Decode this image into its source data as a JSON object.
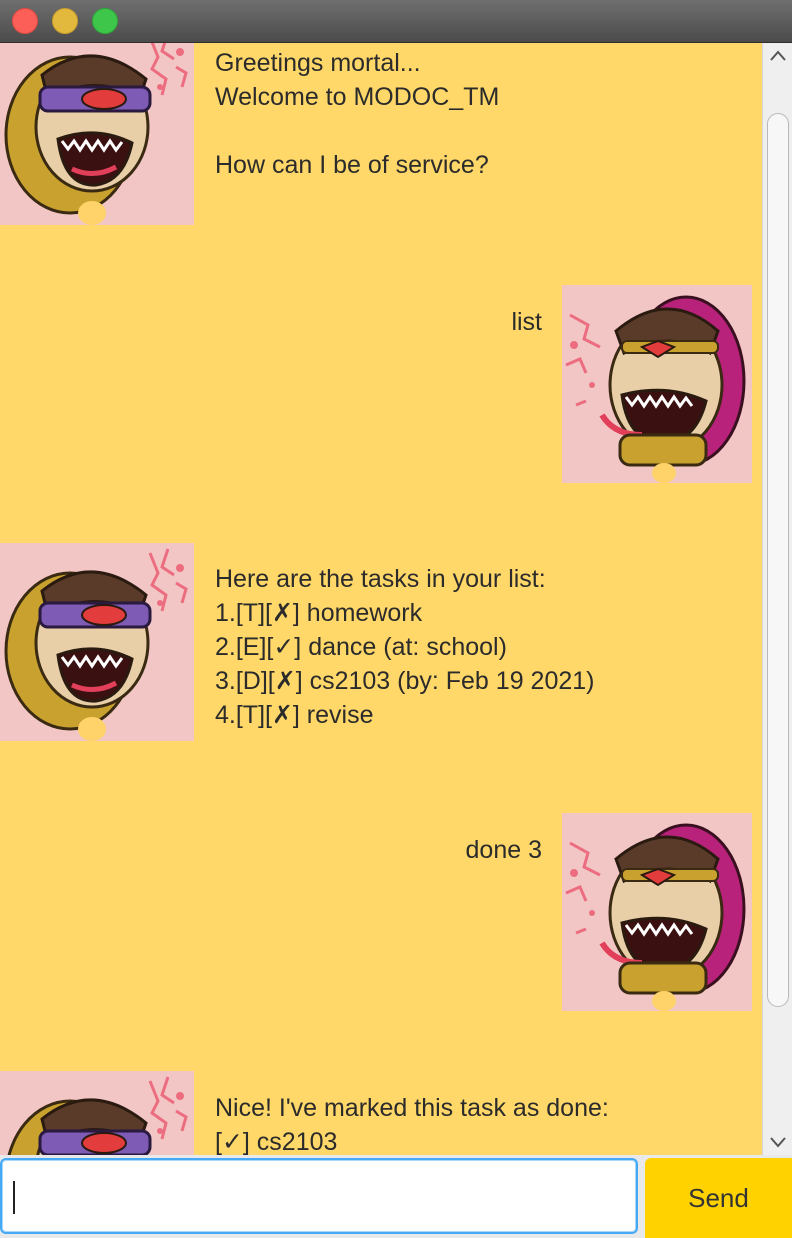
{
  "window": {
    "title": ""
  },
  "messages": [
    {
      "sender": "bot",
      "text": "Greetings mortal...\nWelcome to MODOC_TM\n\nHow can I be of service?"
    },
    {
      "sender": "user",
      "text": "list"
    },
    {
      "sender": "bot",
      "text": "Here are the tasks in your list:\n1.[T][✗] homework\n2.[E][✓] dance (at: school)\n3.[D][✗] cs2103 (by: Feb 19 2021)\n4.[T][✗] revise"
    },
    {
      "sender": "user",
      "text": "done 3"
    },
    {
      "sender": "bot",
      "text": "Nice! I've marked this task as done:\n[✓] cs2103"
    }
  ],
  "input": {
    "value": "",
    "placeholder": ""
  },
  "send_label": "Send",
  "colors": {
    "background": "#ffd869",
    "send_button": "#ffd200",
    "focus_ring": "#46a9f5"
  }
}
